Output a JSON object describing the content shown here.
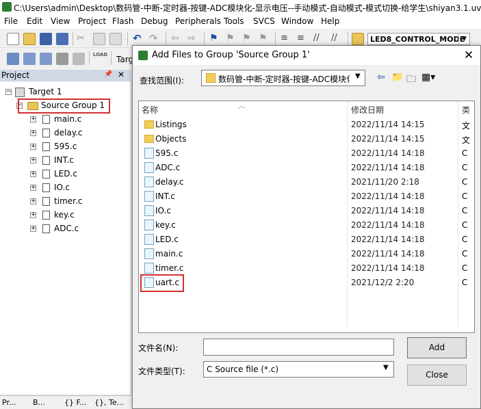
{
  "window": {
    "title": "C:\\Users\\admin\\Desktop\\数码管-中断-定时器-按键-ADC模块化-显示电压--手动模式-自动模式-模式切换-给学生\\shiyan3.1.uv"
  },
  "menu": [
    "File",
    "Edit",
    "View",
    "Project",
    "Flash",
    "Debug",
    "Peripherals",
    "Tools",
    "SVCS",
    "Window",
    "Help"
  ],
  "toolbar": {
    "mode": "LED8_CONTROL_MODE",
    "target_fragment": "Targ",
    "load_label": "LOAD"
  },
  "project_panel": {
    "title": "Project",
    "target": "Target 1",
    "group": "Source Group 1",
    "files": [
      "main.c",
      "delay.c",
      "595.c",
      "INT.c",
      "LED.c",
      "IO.c",
      "timer.c",
      "key.c",
      "ADC.c"
    ],
    "tabs": [
      "Pr...",
      "B...",
      "{} F...",
      "{}, Te..."
    ]
  },
  "dialog": {
    "title": "Add Files to Group 'Source Group 1'",
    "look_in_label": "查找范围(I):",
    "look_in_value": "数码管-中断-定时器-按键-ADC模块化",
    "columns": {
      "name": "名称",
      "date": "修改日期",
      "type": "类"
    },
    "items": [
      {
        "name": "Listings",
        "date": "2022/11/14 14:15",
        "type": "文",
        "kind": "folder"
      },
      {
        "name": "Objects",
        "date": "2022/11/14 14:15",
        "type": "文",
        "kind": "folder"
      },
      {
        "name": "595.c",
        "date": "2022/11/14 14:18",
        "type": "C",
        "kind": "file"
      },
      {
        "name": "ADC.c",
        "date": "2022/11/14 14:18",
        "type": "C",
        "kind": "file"
      },
      {
        "name": "delay.c",
        "date": "2021/11/20 2:18",
        "type": "C",
        "kind": "file"
      },
      {
        "name": "INT.c",
        "date": "2022/11/14 14:18",
        "type": "C",
        "kind": "file"
      },
      {
        "name": "IO.c",
        "date": "2022/11/14 14:18",
        "type": "C",
        "kind": "file"
      },
      {
        "name": "key.c",
        "date": "2022/11/14 14:18",
        "type": "C",
        "kind": "file"
      },
      {
        "name": "LED.c",
        "date": "2022/11/14 14:18",
        "type": "C",
        "kind": "file"
      },
      {
        "name": "main.c",
        "date": "2022/11/14 14:18",
        "type": "C",
        "kind": "file"
      },
      {
        "name": "timer.c",
        "date": "2022/11/14 14:18",
        "type": "C",
        "kind": "file"
      },
      {
        "name": "uart.c",
        "date": "2021/12/2 2:20",
        "type": "C",
        "kind": "file"
      }
    ],
    "file_name_label": "文件名(N):",
    "file_name_value": "",
    "file_type_label": "文件类型(T):",
    "file_type_value": "C Source file (*.c)",
    "add_label": "Add",
    "close_label": "Close"
  },
  "colors": {
    "highlight": "#d32f2f",
    "folder": "#f2cf5b",
    "panel_header": "#cfd8e4"
  }
}
